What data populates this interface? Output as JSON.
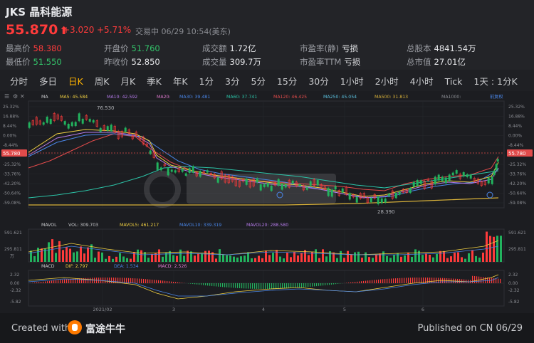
{
  "header": {
    "symbol": "JKS",
    "name": "晶科能源",
    "price": "55.870",
    "change": "+3.020",
    "change_pct": "+5.71%",
    "trade_time": "交易中 06/29 10:54(美东)"
  },
  "stats": {
    "high": {
      "label": "最高价",
      "value": "58.380"
    },
    "low": {
      "label": "最低价",
      "value": "51.550"
    },
    "open": {
      "label": "开盘价",
      "value": "51.760"
    },
    "prev_close": {
      "label": "昨收价",
      "value": "52.850"
    },
    "turnover": {
      "label": "成交额",
      "value": "1.72亿"
    },
    "volume": {
      "label": "成交量",
      "value": "309.7万"
    },
    "pe_static": {
      "label": "市盈率(静)",
      "value": "亏损"
    },
    "pe_ttm": {
      "label": "市盈率TTM",
      "value": "亏损"
    },
    "total_shares": {
      "label": "总股本",
      "value": "4841.54万"
    },
    "market_cap": {
      "label": "总市值",
      "value": "27.01亿"
    }
  },
  "tabs": [
    "分时",
    "多日",
    "日K",
    "周K",
    "月K",
    "季K",
    "年K",
    "1分",
    "3分",
    "5分",
    "15分",
    "30分",
    "1小时",
    "2小时",
    "4小时",
    "Tick",
    "1天 : 1分K"
  ],
  "active_tab": "日K",
  "chart": {
    "ma_row": [
      "MA",
      "MA5: 45.584",
      "MA10: 42.592",
      "MA20:",
      "MA30: 39.481",
      "MA60: 37.741",
      "MA120: 46.425",
      "MA250: 45.054",
      "MA500: 31.813",
      "MA1000:",
      "前复权"
    ],
    "y_left": [
      "25.32%",
      "16.88%",
      "8.44%",
      "0.00%",
      "-8.44%",
      "-16.88%",
      "-25.32%",
      "-33.76%",
      "-42.20%",
      "-50.64%",
      "-59.08%"
    ],
    "y_right": [
      "25.32%",
      "16.88%",
      "8.44%",
      "0.00%",
      "-8.44%",
      "-16.88%",
      "-25.32%",
      "-33.76%",
      "-42.20%",
      "-50.64%",
      "-59.08%"
    ],
    "ref_price_left": "55.780",
    "ref_price_right": "55.780",
    "high_marker": "76.530",
    "low_marker": "28.390",
    "vol_row": [
      "MAVOL",
      "VOL: 309.703",
      "MAVOL5: 461.217",
      "MAVOL10: 339.319",
      "MAVOL20: 288.580"
    ],
    "vol_axis": [
      "591.621",
      "295.811",
      "万"
    ],
    "macd_row": [
      "MACD",
      "DIF: 2.797",
      "DEA: 1.534",
      "MACD: 2.526"
    ],
    "macd_axis": [
      "2.32",
      "0.00",
      "-2.32",
      "-5.82"
    ],
    "x_labels": [
      "2021/02",
      "3",
      "4",
      "5",
      "6"
    ]
  },
  "footer": {
    "created": "Created with",
    "brand": "富途牛牛",
    "published": "Published on CN 06/29"
  }
}
